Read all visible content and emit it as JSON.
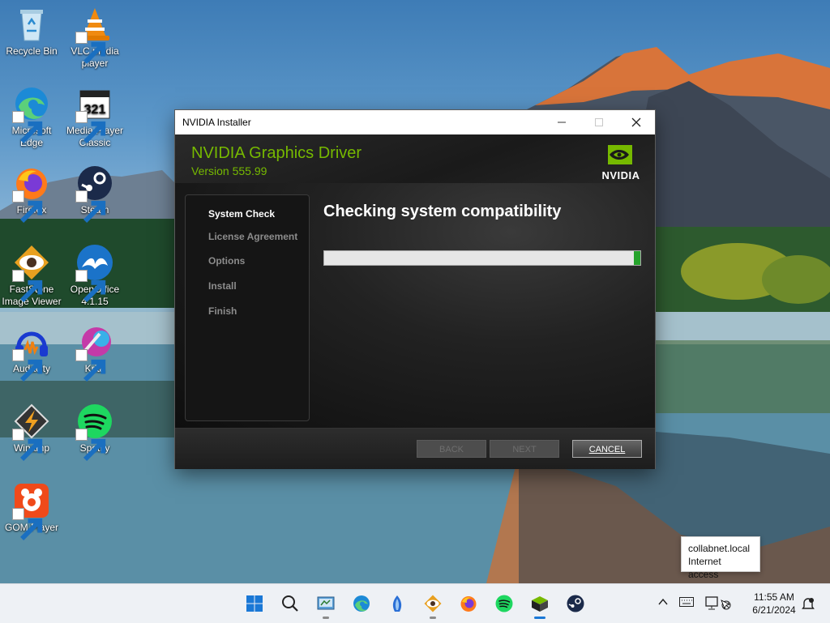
{
  "desktop": {
    "icons": [
      {
        "label": "Recycle Bin"
      },
      {
        "label": "VLC media player"
      },
      {
        "label": "Microsoft Edge"
      },
      {
        "label": "Media Player Classic"
      },
      {
        "label": "Firefox"
      },
      {
        "label": "Steam"
      },
      {
        "label": "FastStone Image Viewer"
      },
      {
        "label": "OpenOffice 4.1.15"
      },
      {
        "label": "Audacity"
      },
      {
        "label": "Krita"
      },
      {
        "label": "Winamp"
      },
      {
        "label": "Spotify"
      },
      {
        "label": "GOM Player"
      }
    ]
  },
  "window": {
    "title": "NVIDIA Installer",
    "product": "NVIDIA Graphics Driver",
    "version": "Version 555.99",
    "logo_text": "NVIDIA",
    "steps": [
      "System Check",
      "License Agreement",
      "Options",
      "Install",
      "Finish"
    ],
    "active_step": "System Check",
    "heading": "Checking system compatibility",
    "progress": 0.02,
    "buttons": {
      "back": "BACK",
      "next": "NEXT",
      "cancel": "CANCEL"
    }
  },
  "tooltip": {
    "line1": "collabnet.local",
    "line2": "Internet access"
  },
  "taskbar": {
    "time": "11:55 AM",
    "date": "6/21/2024",
    "pinned": [
      "start-icon",
      "search-icon",
      "control-panel-icon",
      "edge-icon",
      "app-icon",
      "faststone-icon",
      "firefox-icon",
      "spotify-icon",
      "installer-icon",
      "steam-icon"
    ]
  },
  "colors": {
    "nvidia_green": "#76b900",
    "progress_green": "#25a32b"
  }
}
